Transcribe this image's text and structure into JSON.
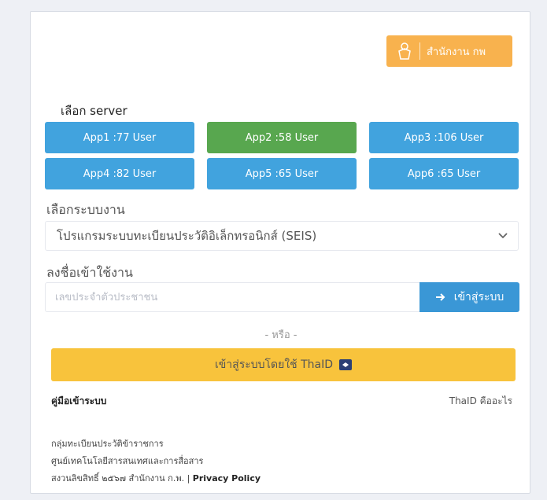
{
  "header": {
    "logo_text": "สำนักงาน กพ",
    "logo_icon": "garuda-emblem-icon"
  },
  "server": {
    "title": "เลือก server",
    "buttons": [
      {
        "label": "App1 :77 User",
        "color": "#41a3de"
      },
      {
        "label": "App2 :58 User",
        "color": "#58a74f"
      },
      {
        "label": "App3 :106 User",
        "color": "#41a3de"
      },
      {
        "label": "App4 :82 User",
        "color": "#41a3de"
      },
      {
        "label": "App5 :65 User",
        "color": "#41a3de"
      },
      {
        "label": "App6 :65 User",
        "color": "#41a3de"
      }
    ]
  },
  "system": {
    "title": "เลือกระบบงาน",
    "selected": "โปรแกรมระบบทะเบียนประวัติอิเล็กทรอนิกส์ (SEIS)"
  },
  "login": {
    "title": "ลงชื่อเข้าใช้งาน",
    "placeholder": "เลขประจำตัวประชาชน",
    "value": "",
    "button_label": "เข้าสู่ระบบ"
  },
  "or_text": "- หรือ -",
  "thaid": {
    "button_label": "เข้าสู่ระบบโดยใช้ ThaID"
  },
  "links": {
    "manual": "คู่มือเข้าระบบ",
    "what_thaid": "ThaID คืออะไร"
  },
  "footer": {
    "line1": "กลุ่มทะเบียนประวัติข้าราชการ",
    "line2": "ศูนย์เทคโนโลยีสารสนเทศและการสื่อสาร",
    "line3": "สงวนลิขสิทธิ์ ๒๕๖๗ สำนักงาน ก.พ. |",
    "privacy": "Privacy Policy"
  },
  "colors": {
    "accent_blue": "#41a3de",
    "accent_green": "#58a74f",
    "logo_orange": "#f8b24e",
    "thaid_yellow": "#f8c33c"
  }
}
